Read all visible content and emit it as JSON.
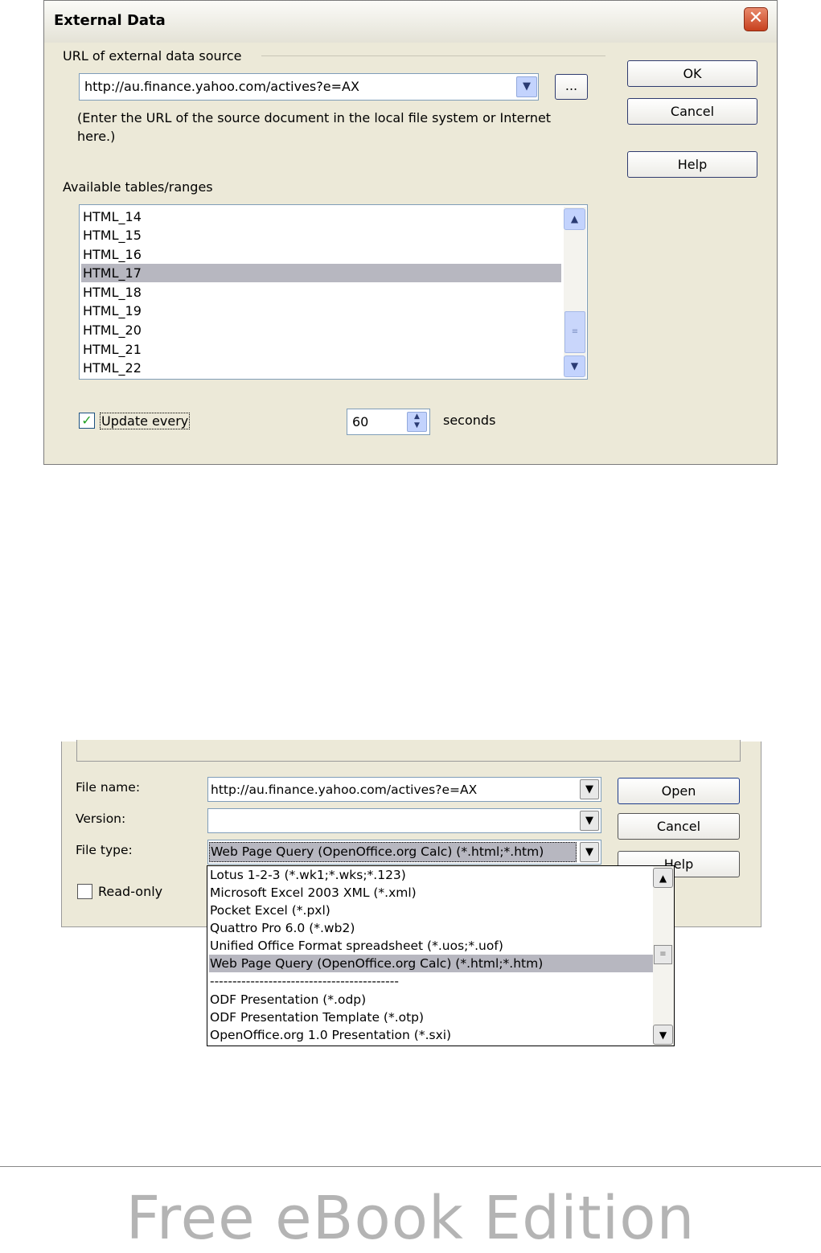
{
  "external_data": {
    "title": "External Data",
    "url_group_label": "URL of external data source",
    "url_value": "http://au.finance.yahoo.com/actives?e=AX",
    "browse_label": "...",
    "hint": "(Enter the URL of the source document in the local file system or Internet here.)",
    "tables_label": "Available tables/ranges",
    "tables": [
      "HTML_14",
      "HTML_15",
      "HTML_16",
      "HTML_17",
      "HTML_18",
      "HTML_19",
      "HTML_20",
      "HTML_21",
      "HTML_22"
    ],
    "selected_table": "HTML_17",
    "update_label": "Update every",
    "update_checked": true,
    "interval_value": "60",
    "interval_unit": "seconds",
    "ok_label": "OK",
    "cancel_label": "Cancel",
    "help_label": "Help"
  },
  "file_dialog": {
    "filename_label": "File name:",
    "filename_value": "http://au.finance.yahoo.com/actives?e=AX",
    "version_label": "Version:",
    "version_value": "",
    "filetype_label": "File type:",
    "filetype_value": "Web Page Query (OpenOffice.org Calc) (*.html;*.htm)",
    "readonly_label": "Read-only",
    "readonly_checked": false,
    "open_label": "Open",
    "cancel_label": "Cancel",
    "help_label": "Help",
    "filetype_options": [
      "Lotus 1-2-3 (*.wk1;*.wks;*.123)",
      "Microsoft Excel 2003 XML (*.xml)",
      "Pocket Excel (*.pxl)",
      "Quattro Pro 6.0 (*.wb2)",
      "Unified Office Format spreadsheet (*.uos;*.uof)",
      "Web Page Query (OpenOffice.org Calc) (*.html;*.htm)",
      "------------------------------------------",
      "ODF Presentation (*.odp)",
      "ODF Presentation Template (*.otp)",
      "OpenOffice.org 1.0 Presentation (*.sxi)"
    ]
  },
  "footer": {
    "text": "Free eBook Edition"
  }
}
